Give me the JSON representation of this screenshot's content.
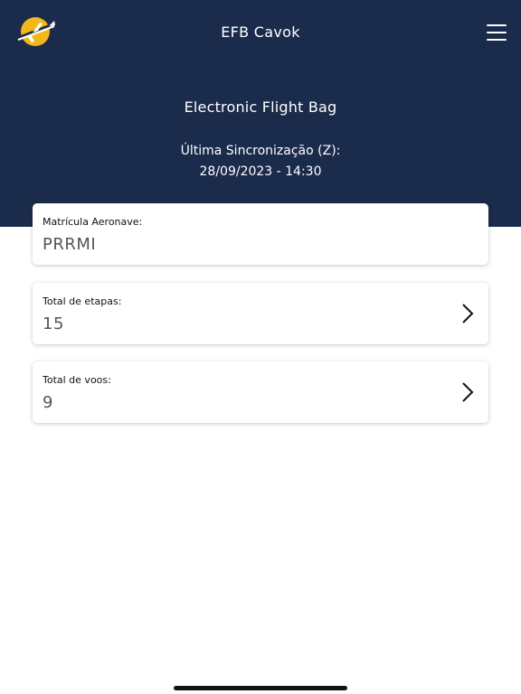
{
  "header": {
    "app_title": "EFB Cavok",
    "subtitle": "Electronic Flight Bag",
    "sync_label": "Última Sincronização (Z):",
    "sync_value": "28/09/2023 - 14:30"
  },
  "icons": {
    "logo": "airplane-sun-logo",
    "menu": "hamburger-menu-icon",
    "chevron": "chevron-right-icon"
  },
  "cards": {
    "aircraft": {
      "label": "Matrícula Aeronave:",
      "value": "PRRMI"
    },
    "legs": {
      "label": "Total de etapas:",
      "value": "15"
    },
    "flights": {
      "label": "Total de voos:",
      "value": "9"
    }
  },
  "colors": {
    "header_bg": "#1a2b4b",
    "logo_yellow": "#f3b719"
  }
}
